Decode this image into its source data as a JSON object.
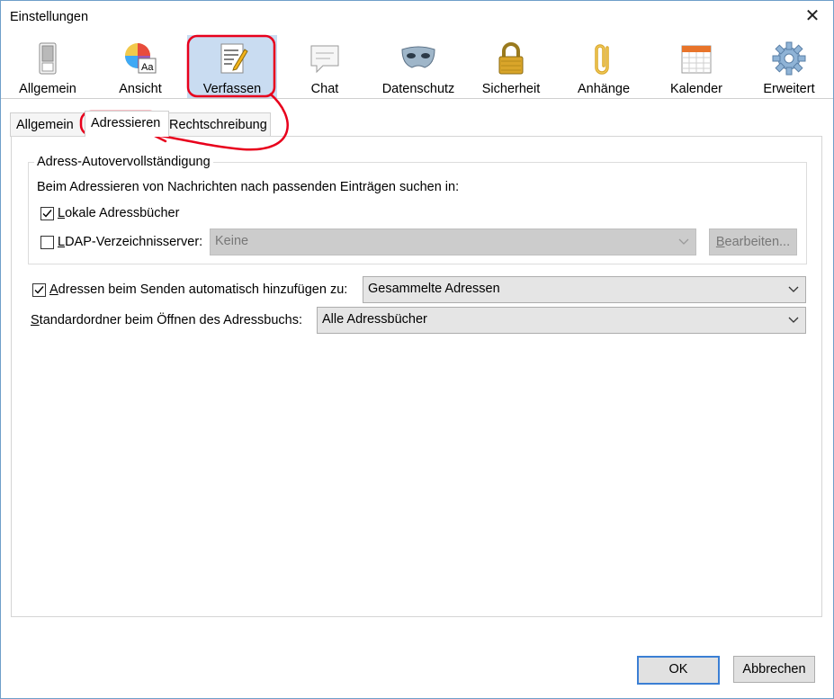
{
  "window": {
    "title": "Einstellungen"
  },
  "toolbar": {
    "items": [
      {
        "label": "Allgemein",
        "icon": "switch-icon"
      },
      {
        "label": "Ansicht",
        "icon": "palette-icon"
      },
      {
        "label": "Verfassen",
        "icon": "compose-icon",
        "selected": true
      },
      {
        "label": "Chat",
        "icon": "chat-icon"
      },
      {
        "label": "Datenschutz",
        "icon": "mask-icon"
      },
      {
        "label": "Sicherheit",
        "icon": "padlock-icon"
      },
      {
        "label": "Anhänge",
        "icon": "paperclip-icon"
      },
      {
        "label": "Kalender",
        "icon": "calendar-icon"
      },
      {
        "label": "Erweitert",
        "icon": "gear-icon"
      }
    ]
  },
  "tabs": [
    {
      "label": "Allgemein"
    },
    {
      "label": "Adressieren",
      "active": true
    },
    {
      "label": "Rechtschreibung"
    }
  ],
  "autocomplete": {
    "group_title": "Adress-Autovervollständigung",
    "description": "Beim Adressieren von Nachrichten nach passenden Einträgen suchen in:",
    "local": {
      "accesskey": "L",
      "label_rest": "okale Adressbücher",
      "checked": true
    },
    "ldap": {
      "accesskey": "L",
      "label_rest": "DAP-Verzeichnisserver:",
      "checked": false,
      "value": "Keine",
      "edit_accesskey": "B",
      "edit_rest": "earbeiten..."
    }
  },
  "auto_add": {
    "accesskey": "A",
    "label_rest": "dressen beim Senden automatisch hinzufügen zu:",
    "checked": true,
    "value": "Gesammelte Adressen"
  },
  "default_folder": {
    "accesskey": "S",
    "label_rest": "tandardordner beim Öffnen des Adressbuchs:",
    "value": "Alle Adressbücher"
  },
  "footer": {
    "ok": "OK",
    "cancel": "Abbrechen"
  },
  "colors": {
    "annotation": "#e8001c",
    "selected_toolbar": "#c9dcf1",
    "default_button_border": "#3b7fd4"
  }
}
